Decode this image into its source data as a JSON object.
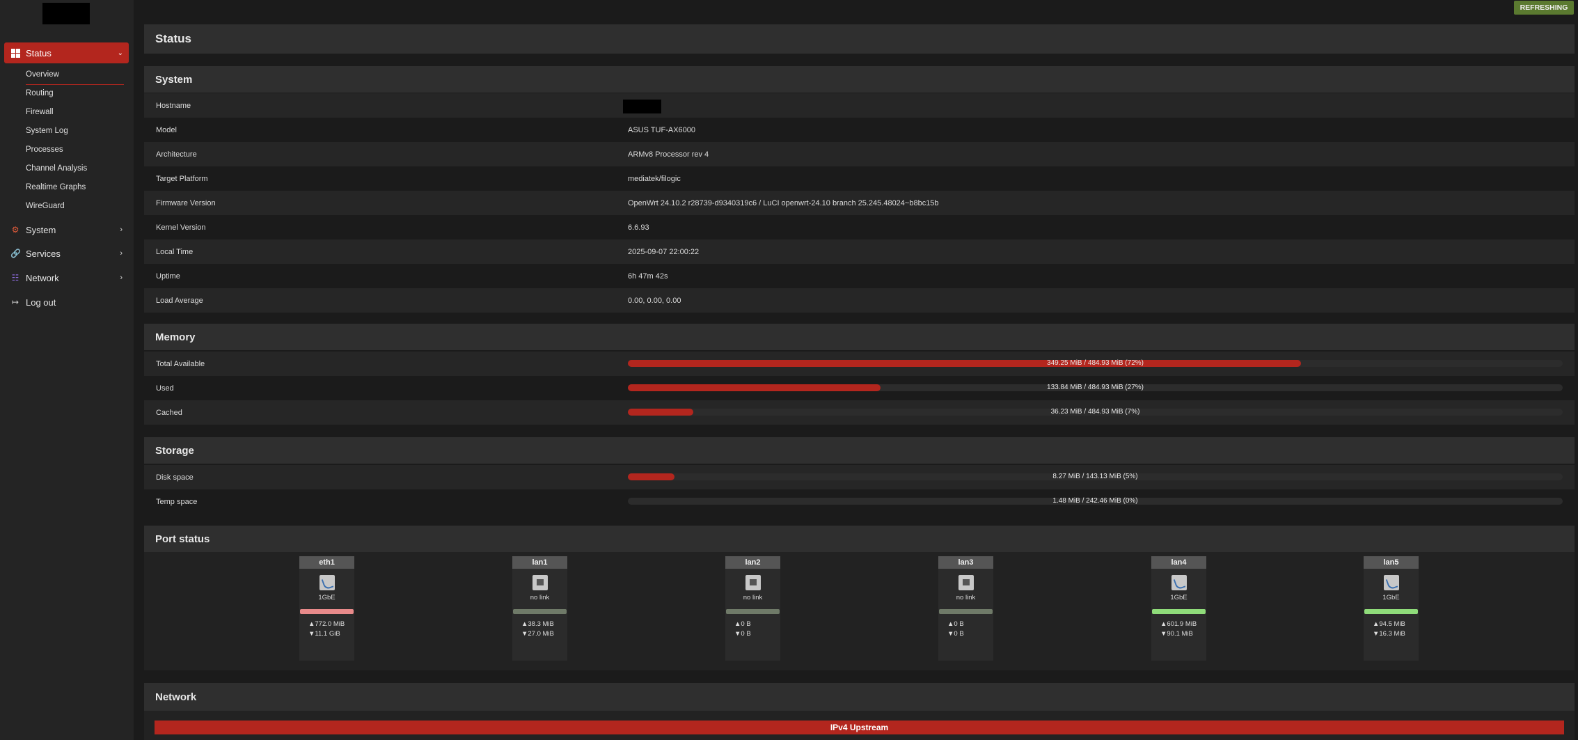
{
  "sidebar": {
    "status_label": "Status",
    "status_sub": [
      "Overview",
      "Routing",
      "Firewall",
      "System Log",
      "Processes",
      "Channel Analysis",
      "Realtime Graphs",
      "WireGuard"
    ],
    "system_label": "System",
    "services_label": "Services",
    "network_label": "Network",
    "logout_label": "Log out"
  },
  "badge": {
    "refreshing": "REFRESHING"
  },
  "page": {
    "title": "Status"
  },
  "system": {
    "heading": "System",
    "rows": [
      {
        "k": "Hostname",
        "v": ""
      },
      {
        "k": "Model",
        "v": "ASUS TUF-AX6000"
      },
      {
        "k": "Architecture",
        "v": "ARMv8 Processor rev 4"
      },
      {
        "k": "Target Platform",
        "v": "mediatek/filogic"
      },
      {
        "k": "Firmware Version",
        "v": "OpenWrt 24.10.2 r28739-d9340319c6 / LuCI openwrt-24.10 branch 25.245.48024~b8bc15b"
      },
      {
        "k": "Kernel Version",
        "v": "6.6.93"
      },
      {
        "k": "Local Time",
        "v": "2025-09-07 22:00:22"
      },
      {
        "k": "Uptime",
        "v": "6h 47m 42s"
      },
      {
        "k": "Load Average",
        "v": "0.00, 0.00, 0.00"
      }
    ]
  },
  "memory": {
    "heading": "Memory",
    "rows": [
      {
        "k": "Total Available",
        "text": "349.25 MiB / 484.93 MiB (72%)",
        "pct": 72
      },
      {
        "k": "Used",
        "text": "133.84 MiB / 484.93 MiB (27%)",
        "pct": 27
      },
      {
        "k": "Cached",
        "text": "36.23 MiB / 484.93 MiB (7%)",
        "pct": 7
      }
    ]
  },
  "storage": {
    "heading": "Storage",
    "rows": [
      {
        "k": "Disk space",
        "text": "8.27 MiB / 143.13 MiB (5%)",
        "pct": 5
      },
      {
        "k": "Temp space",
        "text": "1.48 MiB / 242.46 MiB (0%)",
        "pct": 0
      }
    ]
  },
  "ports": {
    "heading": "Port status",
    "items": [
      {
        "name": "eth1",
        "speed": "1GbE",
        "up": "▲772.0 MiB",
        "down": "▼11.1 GiB",
        "link": true,
        "bar_color": "#e88a8a"
      },
      {
        "name": "lan1",
        "speed": "no link",
        "up": "▲38.3 MiB",
        "down": "▼27.0 MiB",
        "link": false,
        "bar_color": "#6f7a68"
      },
      {
        "name": "lan2",
        "speed": "no link",
        "up": "▲0 B",
        "down": "▼0 B",
        "link": false,
        "bar_color": "#6f7a68"
      },
      {
        "name": "lan3",
        "speed": "no link",
        "up": "▲0 B",
        "down": "▼0 B",
        "link": false,
        "bar_color": "#6f7a68"
      },
      {
        "name": "lan4",
        "speed": "1GbE",
        "up": "▲601.9 MiB",
        "down": "▼90.1 MiB",
        "link": true,
        "bar_color": "#8fdc7a"
      },
      {
        "name": "lan5",
        "speed": "1GbE",
        "up": "▲94.5 MiB",
        "down": "▼16.3 MiB",
        "link": true,
        "bar_color": "#8fdc7a"
      }
    ]
  },
  "network": {
    "heading": "Network",
    "ipv4_label": "IPv4 Upstream"
  }
}
